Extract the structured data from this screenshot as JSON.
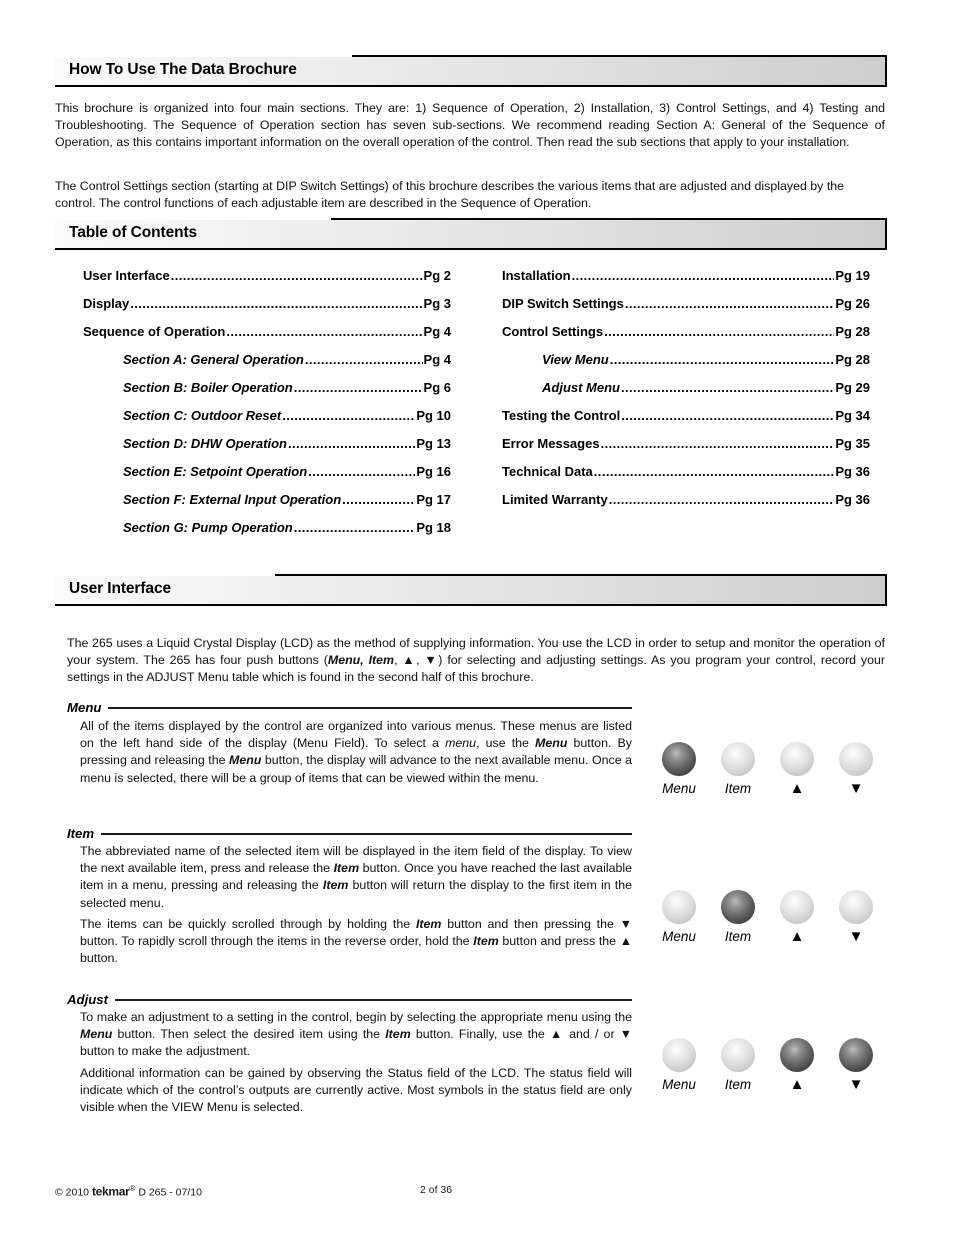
{
  "document": {
    "sections": [
      {
        "title": "How To Use The Data Brochure"
      },
      {
        "title": "Table of Contents"
      },
      {
        "title": "User Interface"
      }
    ]
  },
  "how_to_use": {
    "paragraph_1": "This brochure is organized into four main sections. They are: 1) Sequence of Operation, 2) Installation, 3) Control Settings, and 4) Testing and Troubleshooting. The Sequence of Operation section has seven sub-sections. We recommend reading Section A: General of the Sequence of Operation, as this contains important information on the overall operation of the control. Then read the sub sections that apply to your installation.",
    "paragraph_2": "The Control Settings section (starting at DIP Switch Settings) of this brochure describes the various items that are adjusted and displayed by the control. The control functions of each adjustable item are described in the Sequence of Operation."
  },
  "toc": {
    "left_column": [
      {
        "label": "User Interface",
        "page": "Pg 2",
        "sub": false
      },
      {
        "label": "Display ",
        "page": "Pg 3",
        "sub": false
      },
      {
        "label": "Sequence of Operation ",
        "page": "Pg 4",
        "sub": false
      },
      {
        "label": "Section A: General Operation ",
        "page": "Pg 4",
        "sub": true
      },
      {
        "label": "Section B: Boiler Operation",
        "page": "Pg 6",
        "sub": true
      },
      {
        "label": "Section C: Outdoor Reset",
        "page": "Pg 10",
        "sub": true
      },
      {
        "label": "Section D: DHW Operation ",
        "page": "Pg 13",
        "sub": true
      },
      {
        "label": "Section E: Setpoint Operation ",
        "page": "Pg 16",
        "sub": true
      },
      {
        "label": "Section F: External Input Operation",
        "page": "Pg 17",
        "sub": true
      },
      {
        "label": "Section G: Pump Operation",
        "page": "Pg 18",
        "sub": true
      }
    ],
    "right_column": [
      {
        "label": "Installation",
        "page": "Pg 19",
        "sub": false
      },
      {
        "label": "DIP Switch Settings",
        "page": "Pg 26",
        "sub": false
      },
      {
        "label": "Control Settings",
        "page": "Pg 28",
        "sub": false
      },
      {
        "label": "View Menu ",
        "page": "Pg 28",
        "sub": true
      },
      {
        "label": "Adjust Menu ",
        "page": "Pg 29",
        "sub": true
      },
      {
        "label": "Testing the Control ",
        "page": "Pg 34",
        "sub": false
      },
      {
        "label": "Error Messages",
        "page": "Pg 35",
        "sub": false
      },
      {
        "label": "Technical Data",
        "page": "Pg 36",
        "sub": false
      },
      {
        "label": "Limited Warranty ",
        "page": "Pg 36",
        "sub": false
      }
    ],
    "dot_leader": "................................................................................................"
  },
  "user_interface": {
    "intro": "The 265 uses a Liquid Crystal Display (LCD) as the method of supplying information. You use the LCD in order to setup and monitor the operation of your system. The 265 has four push buttons (Menu, Item, ▲, ▼) for selecting and adjusting settings. As you program your control, record your settings in the ADJUST Menu table which is found in the second half of this brochure.",
    "subsections": [
      {
        "heading": "Menu",
        "paragraphs": [
          "All of the items displayed by the control are organized into various menus. These menus are listed on the left hand side of the display (Menu Field). To select a menu, use the Menu button. By pressing and releasing the Menu button, the display will advance to the next available menu. Once a menu is selected, there will be a group of items that can be viewed within the menu."
        ]
      },
      {
        "heading": "Item",
        "paragraphs": [
          "The abbreviated name of the selected item will be displayed in the item field of the display. To view the next available item, press and release the Item button. Once you have reached the last available item in a menu, pressing and releasing the Item button will return the display to the first item in the selected menu.",
          "The items can be quickly scrolled through by holding the Item button and then pressing the ▼ button. To rapidly scroll through the items in the reverse order, hold the Item button and press the ▲ button."
        ]
      },
      {
        "heading": "Adjust",
        "paragraphs": [
          "To make an adjustment to a setting in the control, begin by selecting the appropriate menu using the Menu button. Then select the desired item using the Item button. Finally, use the ▲ and / or ▼ button to make the adjustment.",
          "Additional information can be gained by observing the Status field of the LCD. The status field will indicate which of the control's outputs are currently active. Most symbols in the status field are only visible when the VIEW Menu is selected."
        ]
      }
    ],
    "button_groups": [
      {
        "name": "menu-highlighted",
        "buttons": [
          {
            "label": "Menu",
            "glyph": false,
            "active": true
          },
          {
            "label": "Item",
            "glyph": false,
            "active": false
          },
          {
            "label": "▲",
            "glyph": true,
            "active": false
          },
          {
            "label": "▼",
            "glyph": true,
            "active": false
          }
        ]
      },
      {
        "name": "item-highlighted",
        "buttons": [
          {
            "label": "Menu",
            "glyph": false,
            "active": false
          },
          {
            "label": "Item",
            "glyph": false,
            "active": true
          },
          {
            "label": "▲",
            "glyph": true,
            "active": false
          },
          {
            "label": "▼",
            "glyph": true,
            "active": false
          }
        ]
      },
      {
        "name": "arrows-highlighted",
        "buttons": [
          {
            "label": "Menu",
            "glyph": false,
            "active": false
          },
          {
            "label": "Item",
            "glyph": false,
            "active": false
          },
          {
            "label": "▲",
            "glyph": true,
            "active": true
          },
          {
            "label": "▼",
            "glyph": true,
            "active": true
          }
        ]
      }
    ]
  },
  "footer": {
    "copyright": "© 2010",
    "brand": "tekmar",
    "registered": "®",
    "doc_code": "D 265 - 07/10",
    "page_number": "2 of 36"
  }
}
